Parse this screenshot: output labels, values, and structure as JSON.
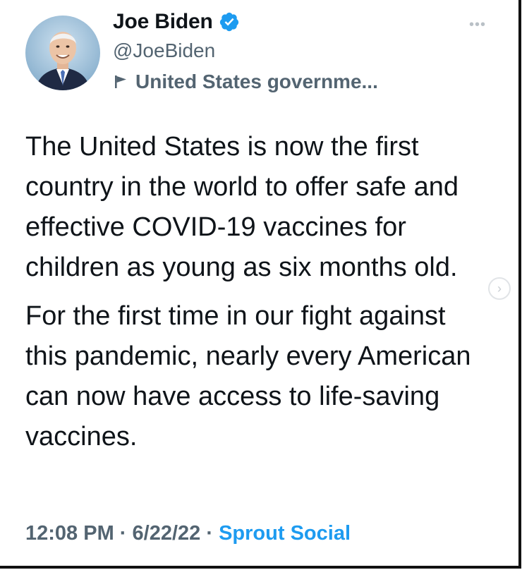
{
  "author": {
    "name": "Joe Biden",
    "handle": "@JoeBiden",
    "label": "United States governme..."
  },
  "tweet": {
    "paragraphs": [
      "The United States is now the first country in the world to offer safe and effective COVID-19 vaccines for children as young as six months old.",
      "For the first time in our fight against this pandemic, nearly every American can now have access to life-saving vaccines."
    ]
  },
  "meta": {
    "time": "12:08 PM",
    "separator": "·",
    "date": "6/22/22",
    "source": "Sprout Social"
  },
  "icons": {
    "verified": "verified-badge-icon",
    "label": "flag-icon",
    "more": "more-options-icon",
    "next": "chevron-right-icon"
  },
  "colors": {
    "text": "#0f1419",
    "secondary": "#536471",
    "accent": "#1d9bf0"
  }
}
